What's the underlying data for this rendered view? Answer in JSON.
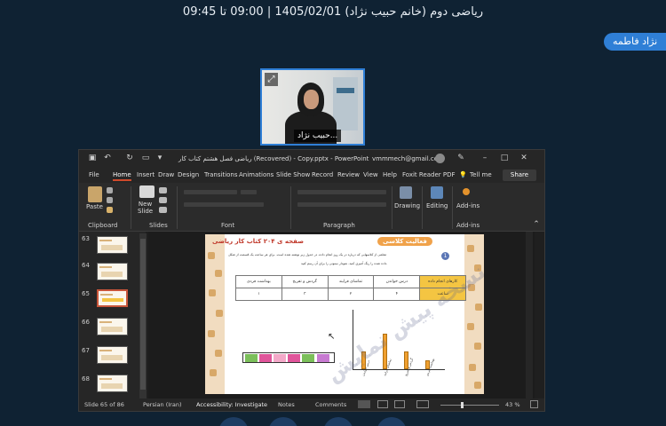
{
  "meeting": {
    "title": "ریاضی دوم (خانم حبیب نژاد) 1405/02/01 | 09:00 تا 09:45",
    "participant_chip": "نژاد فاطمه"
  },
  "webcam": {
    "name_tag": "حبیب نژاد...",
    "pin_icon": "expand-icon"
  },
  "powerpoint": {
    "file_title": "ریاضی فصل هشتم کتاب کار (Recovered) - Copy.pptx - PowerPoint",
    "account": "vmmmech@gmail.com",
    "tell_me": "Tell me",
    "share": "Share",
    "tabs": [
      "File",
      "Home",
      "Insert",
      "Draw",
      "Design",
      "Transitions",
      "Animations",
      "Slide Show",
      "Record",
      "Review",
      "View",
      "Help",
      "Foxit Reader PDF"
    ],
    "active_tab": "Home",
    "ribbon": {
      "paste": "Paste",
      "new_slide": "New\nSlide",
      "drawing": "Drawing",
      "editing": "Editing",
      "addins": "Add-ins",
      "groups": {
        "clipboard": "Clipboard",
        "slides": "Slides",
        "font": "Font",
        "paragraph": "Paragraph",
        "addins": "Add-ins"
      }
    },
    "thumbnails": [
      {
        "num": "63"
      },
      {
        "num": "64"
      },
      {
        "num": "65"
      },
      {
        "num": "66"
      },
      {
        "num": "67"
      },
      {
        "num": "68"
      }
    ],
    "selected_thumbnail": "65",
    "slide": {
      "heading_left": "صفحه ی ۲۰۴ کتاب کار ریاضی",
      "heading_right": "فعالیت کلاسی",
      "number": "1",
      "instruction_1": "معلمی از کلاسهایی که درباره در یک روز انجام داده، در جدول زیر نوشته شده است. برای هر ساعت یک قسمت از شکل",
      "instruction_2": "داده شده را رنگ آمیزی کنید. نمودار ستونی را برای آن رسم کنید.",
      "table": {
        "header": [
          "بهداشت فردی",
          "گردش و تفریح",
          "تماشای فرایند",
          "درس خواندن",
          "کارهای انجام داده"
        ],
        "values": [
          "۱",
          "۳",
          "۲",
          "۴",
          "ساعت"
        ]
      },
      "watermark": "نسخه پیش نمایش"
    },
    "chart_data": {
      "type": "bar",
      "categories": [
        "درس خواندن",
        "تماشای فرایند",
        "گردش و تفریح",
        "بهداشت فردی"
      ],
      "values": [
        2,
        4,
        2,
        1
      ],
      "ylim": [
        0,
        6
      ]
    },
    "status": {
      "slide_of": "Slide 65 of 86",
      "language": "Persian (Iran)",
      "accessibility": "Accessibility: Investigate",
      "notes": "Notes",
      "comments": "Comments",
      "zoom": "43 %"
    }
  },
  "colors": {
    "page_bg": "#0f2233",
    "accent": "#2f7fd6",
    "ppt_tab_active": "#d04a2b",
    "bar_fill": "#f0a030"
  }
}
